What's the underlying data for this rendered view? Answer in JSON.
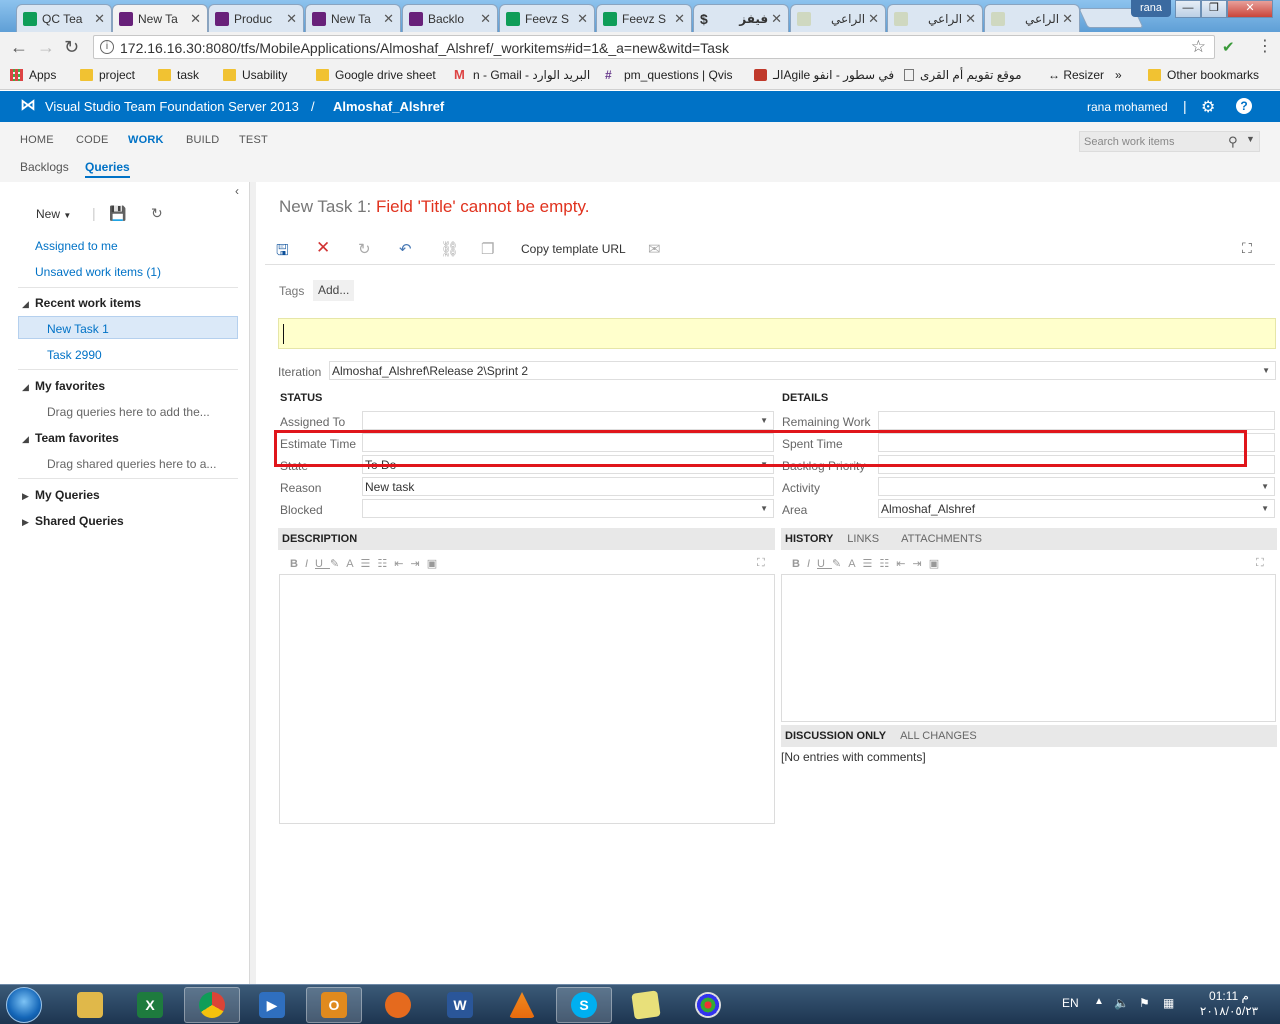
{
  "browser": {
    "tabs": [
      {
        "label": "QC Tea",
        "icon": "sheets-icon",
        "color": "#0f9d58"
      },
      {
        "label": "New Ta",
        "icon": "vs-icon",
        "color": "#68217a",
        "active": true
      },
      {
        "label": "Produc",
        "icon": "vs-icon",
        "color": "#68217a"
      },
      {
        "label": "New Ta",
        "icon": "vs-icon",
        "color": "#68217a"
      },
      {
        "label": "Backlo",
        "icon": "vs-icon",
        "color": "#68217a"
      },
      {
        "label": "Feevz S",
        "icon": "sheets-icon",
        "color": "#0f9d58"
      },
      {
        "label": "Feevz S",
        "icon": "sheets-icon",
        "color": "#0f9d58"
      },
      {
        "label": "فيفز",
        "icon": "dollar-icon",
        "color": "#333333"
      },
      {
        "label": "الراعي",
        "icon": "page-icon",
        "color": "#9aa88a"
      },
      {
        "label": "الراعي",
        "icon": "page-icon",
        "color": "#9aa88a"
      },
      {
        "label": "الراعي",
        "icon": "page-icon",
        "color": "#9aa88a"
      }
    ],
    "user_chip": "rana",
    "url": "172.16.16.30:8080/tfs/MobileApplications/Almoshaf_Alshref/_workitems#id=1&_a=new&witd=Task",
    "bookmarks": [
      {
        "label": "Apps",
        "icon": "apps-grid-icon"
      },
      {
        "label": "project",
        "icon": "folder-icon"
      },
      {
        "label": "task",
        "icon": "folder-icon"
      },
      {
        "label": "Usability",
        "icon": "folder-icon"
      },
      {
        "label": "Google drive sheet",
        "icon": "folder-icon"
      },
      {
        "label": "n - Gmail - البريد الوارد",
        "icon": "gmail-icon"
      },
      {
        "label": "pm_questions | Qvis",
        "icon": "slack-icon"
      },
      {
        "label": "الـAgile في سطور - انفو",
        "icon": "red-icon"
      },
      {
        "label": "موقع تقويم أم القرى",
        "icon": "page-icon"
      },
      {
        "label": "↔ Resizer",
        "icon": "none"
      },
      {
        "label": "»",
        "icon": "none"
      },
      {
        "label": "Other bookmarks",
        "icon": "folder-icon"
      }
    ]
  },
  "tfs": {
    "product": "Visual Studio Team Foundation Server 2013",
    "separator": "/",
    "project": "Almoshaf_Alshref",
    "user": "rana mohamed",
    "hubs": [
      "HOME",
      "CODE",
      "WORK",
      "BUILD",
      "TEST"
    ],
    "active_hub": "WORK",
    "subnav": [
      "Backlogs",
      "Queries"
    ],
    "active_subnav": "Queries",
    "search_placeholder": "Search work items"
  },
  "left": {
    "new_label": "New",
    "links": [
      "Assigned to me",
      "Unsaved work items (1)"
    ],
    "recent_header": "Recent work items",
    "recent_items": [
      "New Task 1",
      "Task 2990"
    ],
    "my_favorites": "My favorites",
    "my_favorites_hint": "Drag queries here to add the...",
    "team_favorites": "Team favorites",
    "team_favorites_hint": "Drag shared queries here to a...",
    "my_queries": "My Queries",
    "shared_queries": "Shared Queries"
  },
  "form": {
    "title_prefix": "New Task 1: ",
    "title_error": "Field 'Title' cannot be empty.",
    "copy_template_url": "Copy template URL",
    "tags_label": "Tags",
    "tags_add": "Add...",
    "iteration_label": "Iteration",
    "iteration_value": "Almoshaf_Alshref\\Release 2\\Sprint 2",
    "status_header": "STATUS",
    "details_header": "DETAILS",
    "assigned_to_label": "Assigned To",
    "estimate_time_label": "Estimate Time",
    "state_label": "State",
    "state_value": "To Do",
    "reason_label": "Reason",
    "reason_value": "New task",
    "blocked_label": "Blocked",
    "remaining_work_label": "Remaining Work",
    "spent_time_label": "Spent Time",
    "backlog_priority_label": "Backlog Priority",
    "activity_label": "Activity",
    "area_label": "Area",
    "area_value": "Almoshaf_Alshref",
    "description_header": "DESCRIPTION",
    "history_header": "HISTORY",
    "links_tab": "LINKS",
    "attachments_tab": "ATTACHMENTS",
    "discussion_only": "DISCUSSION ONLY",
    "all_changes": "ALL CHANGES",
    "no_entries": "[No entries with comments]",
    "highlight_color": "#e0151b"
  },
  "taskbar": {
    "apps": [
      "explorer-icon",
      "excel-icon",
      "chrome-icon",
      "media-player-icon",
      "outlook-icon",
      "firefox-icon",
      "word-icon",
      "vlc-icon",
      "skype-icon",
      "sticky-notes-icon",
      "paint-icon"
    ],
    "language": "EN",
    "time": "01:11 م",
    "date": "٢٠١٨/٠٥/٢٣"
  }
}
